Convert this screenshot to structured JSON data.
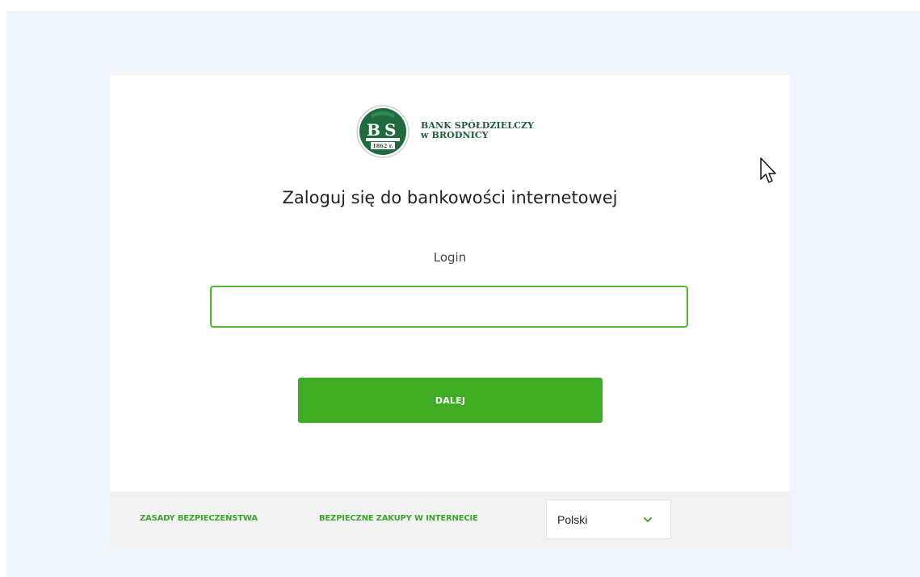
{
  "brand": {
    "logo_initials": [
      "B",
      "S"
    ],
    "logo_subtext": "1862 r.",
    "name_line1": "BANK SPÓŁDZIELCZY",
    "name_line2": "w BRODNICY"
  },
  "login": {
    "title": "Zaloguj się do bankowości internetowej",
    "label": "Login",
    "input_value": "",
    "submit_label": "DALEJ"
  },
  "footer": {
    "security_link": "ZASADY BEZPIECZEŃSTWA",
    "shopping_link": "BEZPIECZNE ZAKUPY W INTERNECIE",
    "language": {
      "selected": "Polski"
    }
  },
  "colors": {
    "accent_green": "#3fad23",
    "logo_green": "#1f5c3a",
    "page_bg": "#f0f4fb",
    "footer_bg": "#f2f2f2"
  },
  "icons": {
    "language_dropdown": "chevron-down-icon",
    "pointer": "mouse-cursor-icon"
  }
}
